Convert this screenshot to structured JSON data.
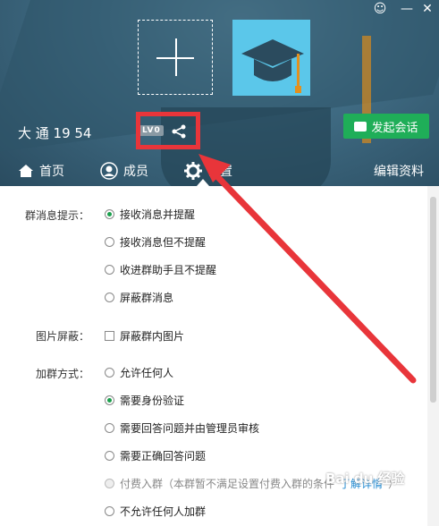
{
  "header": {
    "group_name_visible": "大 通 19        54",
    "level_badge": "LV0",
    "start_chat_label": "发起会话"
  },
  "nav": {
    "home": "首页",
    "members": "成员",
    "settings": "设置",
    "edit_profile": "编辑资料"
  },
  "settings": {
    "message_notice": {
      "label": "群消息提示：",
      "options": [
        "接收消息并提醒",
        "接收消息但不提醒",
        "收进群助手且不提醒",
        "屏蔽群消息"
      ],
      "selected_index": 0
    },
    "image_block": {
      "label": "图片屏蔽：",
      "option": "屏蔽群内图片",
      "checked": false
    },
    "join_method": {
      "label": "加群方式：",
      "options": [
        "允许任何人",
        "需要身份验证",
        "需要回答问题并由管理员审核",
        "需要正确回答问题",
        "付费入群（本群暂不满足设置付费入群的条件",
        "不允许任何人加群"
      ],
      "paid_link": "了解详情",
      "paid_close": "）",
      "selected_index": 1
    }
  },
  "colors": {
    "accent_green": "#1fae58",
    "highlight_red": "#e8353a",
    "link_blue": "#1e88d0"
  },
  "watermark": "Bai du 经验"
}
